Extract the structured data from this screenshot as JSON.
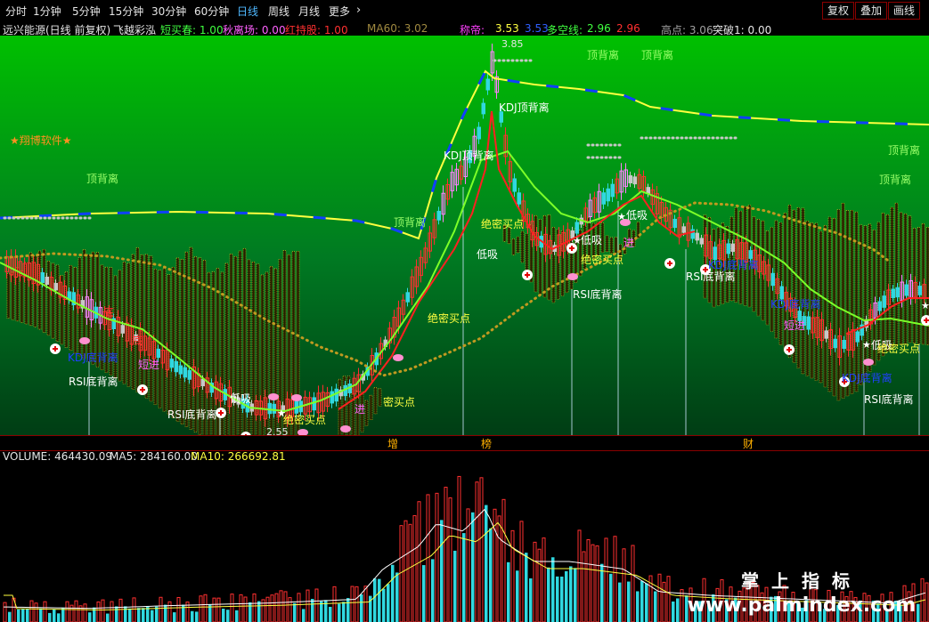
{
  "toolbar": {
    "periods": [
      "分时",
      "1分钟",
      "5分钟",
      "15分钟",
      "30分钟",
      "60分钟",
      "日线",
      "周线",
      "月线",
      "更多"
    ],
    "active_period": "日线",
    "right_buttons": [
      "复权",
      "叠加",
      "画线"
    ]
  },
  "info": {
    "title": "远兴能源(日线 前复权)",
    "indicator_name": "飞越彩泓",
    "short_buy": "短买春: 1.00",
    "autumn_leave": "秋离场: 0.00",
    "red_hold": "红持股: 1.00",
    "ma60": "MA60: 3.02",
    "chengdi_label": "称帝:",
    "chengdi_val1": "3.53",
    "chengdi_val2": "3.53",
    "duokong_label": "多空线:",
    "duokong_val1": "2.96",
    "duokong_val2": "2.96",
    "high": "高点: 3.06",
    "breakthrough": "突破1: 0.00"
  },
  "chart_labels": {
    "high_price": "3.85",
    "low_price": "2.55",
    "brand": "★翔博软件★",
    "top_div": "顶背离",
    "kdj_top_div": "KDJ顶背离",
    "kdj_bottom_div": "KDJ底背离",
    "rsi_bottom_div": "RSI底背离",
    "low_buy": "低吸",
    "absolute_buy": "绝密买点",
    "dense_buy": "密买点",
    "short_in": "短进",
    "bottom": "底",
    "enter": "进"
  },
  "separator_chars": [
    "增",
    "榜",
    "财"
  ],
  "volume": {
    "volume": "VOLUME: 464430.09",
    "ma5": "MA5: 284160.00",
    "ma10": "MA10: 266692.81"
  },
  "watermark": {
    "line1": "掌上指标",
    "line2": "www.palmindex.com"
  },
  "colors": {
    "up": "#ff3030",
    "down": "#30d8e0",
    "ma_green": "#7dff28",
    "ma_yellow": "#ffff40",
    "ma_red": "#ff2020",
    "dots_orange": "#c09a20",
    "pink_candle": "#ff80ff",
    "bg_top": "#00c000",
    "bg_bottom": "#003c14"
  }
}
